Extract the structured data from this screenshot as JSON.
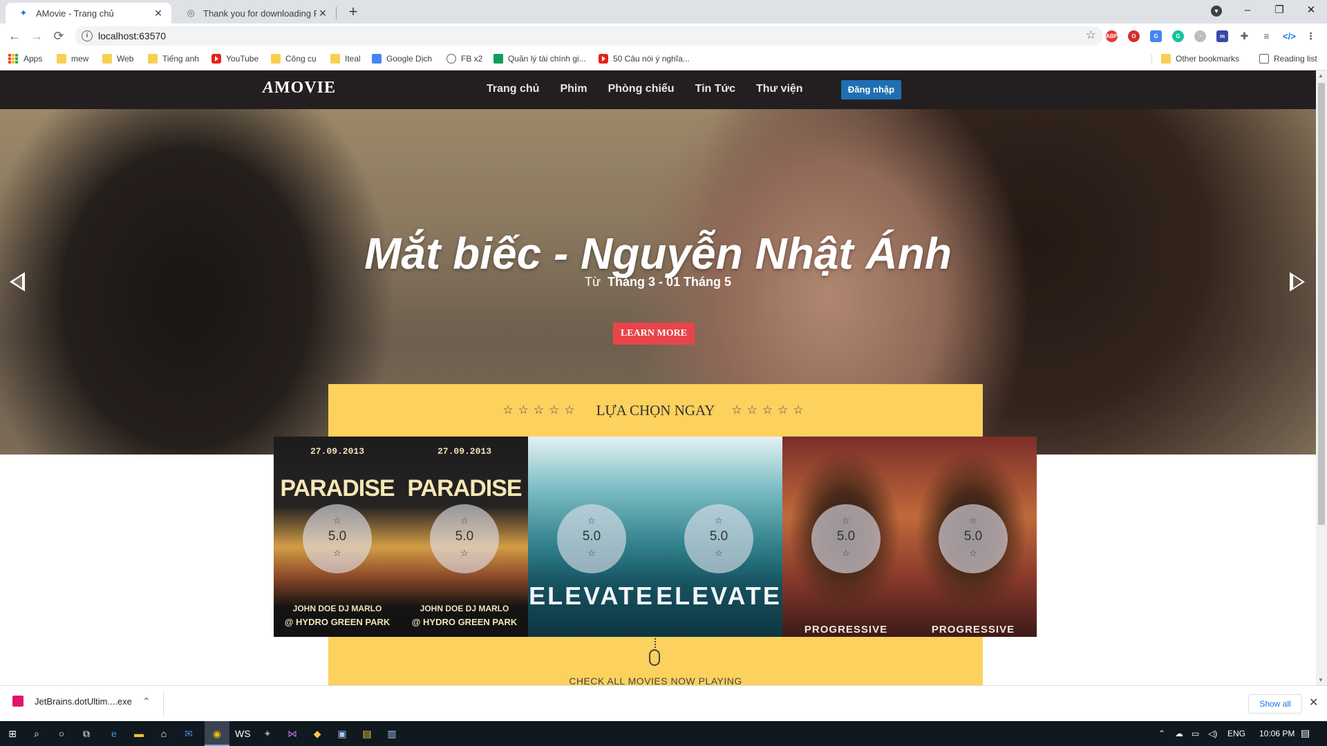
{
  "browser": {
    "tabs": [
      {
        "title": "AMovie - Trang chủ",
        "active": true
      },
      {
        "title": "Thank you for downloading ReSh",
        "active": false
      }
    ],
    "new_tab": "+",
    "window_controls": {
      "minimize": "–",
      "restore": "❐",
      "close": "✕"
    },
    "nav": {
      "back": "←",
      "forward": "→",
      "reload": "⟳"
    },
    "url": "localhost:63570",
    "bookmarks": {
      "apps": "Apps",
      "mew": "mew",
      "web": "Web",
      "tieng_anh": "Tiếng anh",
      "youtube": "YouTube",
      "cong_cu": "Công cụ",
      "iteal": "Iteal",
      "google_dich": "Google Dịch",
      "fb_x2": "FB x2",
      "quan_ly": "Quản lý tài chính gi...",
      "cau_noi": "50 Câu nói ý nghĩa...",
      "other": "Other bookmarks",
      "reading": "Reading list"
    }
  },
  "site": {
    "logo_a": "A",
    "logo_text": "MOVIE",
    "menu": [
      "Trang chủ",
      "Phim",
      "Phòng chiếu",
      "Tin Tức",
      "Thư viện"
    ],
    "login": "Đăng nhập"
  },
  "hero": {
    "title": "Mắt biếc - Nguyễn Nhật Ánh",
    "from": "Từ",
    "date_range": "Tháng 3 -  01 Tháng 5",
    "cta": "LEARN MORE"
  },
  "pick": {
    "stars": "☆☆☆☆☆",
    "title": "LỰA CHỌN NGAY"
  },
  "posters": [
    {
      "style": "dark",
      "date": "27.09.2013",
      "name": "PARADISE",
      "line1": "JOHN DOE  DJ MARLO",
      "line2": "@ HYDRO GREEN PARK",
      "rating": "5.0"
    },
    {
      "style": "dark",
      "date": "27.09.2013",
      "name": "PARADISE",
      "line1": "JOHN DOE  DJ MARLO",
      "line2": "@ HYDRO GREEN PARK",
      "rating": "5.0"
    },
    {
      "style": "teal",
      "name": "ELEVATE",
      "rating": "5.0"
    },
    {
      "style": "teal",
      "name": "ELEVATE",
      "rating": "5.0"
    },
    {
      "style": "fire",
      "name": "PROGRESSIVE",
      "rating": "5.0"
    },
    {
      "style": "fire",
      "name": "PROGRESSIVE",
      "rating": "5.0"
    }
  ],
  "rating_star": "☆",
  "check": {
    "text": "CHECK ALL MOVIES NOW PLAYING"
  },
  "downloads": {
    "file": "JetBrains.dotUltim....exe",
    "show_all": "Show all",
    "close": "✕"
  },
  "taskbar": {
    "lang": "ENG",
    "time": "10:06 PM"
  }
}
